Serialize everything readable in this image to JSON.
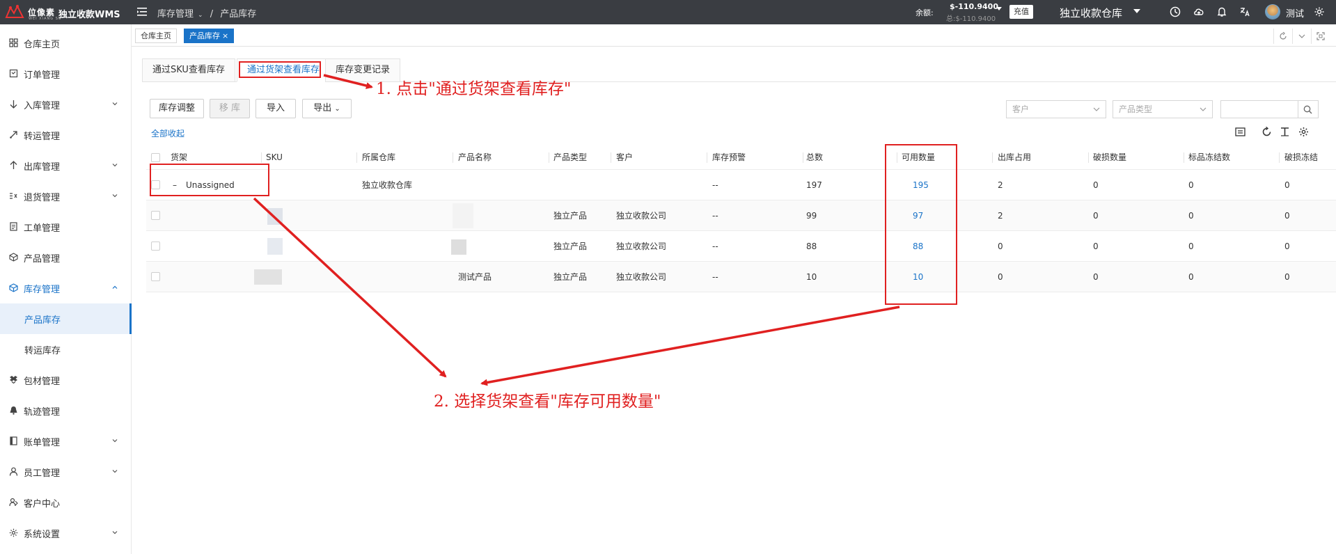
{
  "app": {
    "logo_text_cn": "位像素",
    "logo_text_en": "WEI XIANG SU",
    "name": "独立收款WMS"
  },
  "header": {
    "breadcrumb": [
      "库存管理",
      "/",
      "产品库存"
    ],
    "balance_label": "余额:",
    "balance_value": "$-110.9400",
    "balance_total": "总:$-110.9400",
    "recharge_label": "充值",
    "warehouse": "独立收款仓库",
    "user": "测试",
    "icons": [
      "clock-icon",
      "cloud-upload-icon",
      "bell-icon",
      "translate-icon"
    ]
  },
  "sidebar": {
    "items": [
      {
        "label": "仓库主页",
        "icon": "dashboard-icon",
        "expandable": false
      },
      {
        "label": "订单管理",
        "icon": "order-icon",
        "expandable": false
      },
      {
        "label": "入库管理",
        "icon": "inbound-icon",
        "expandable": true
      },
      {
        "label": "转运管理",
        "icon": "transfer-icon",
        "expandable": false
      },
      {
        "label": "出库管理",
        "icon": "outbound-icon",
        "expandable": true
      },
      {
        "label": "退货管理",
        "icon": "return-icon",
        "expandable": true
      },
      {
        "label": "工单管理",
        "icon": "workorder-icon",
        "expandable": false
      },
      {
        "label": "产品管理",
        "icon": "product-icon",
        "expandable": false
      },
      {
        "label": "库存管理",
        "icon": "inventory-icon",
        "expandable": true,
        "expanded": true
      },
      {
        "label": "产品库存",
        "sub": true,
        "active": true
      },
      {
        "label": "转运库存",
        "sub": true
      },
      {
        "label": "包材管理",
        "icon": "package-icon",
        "expandable": false
      },
      {
        "label": "轨迹管理",
        "icon": "track-icon",
        "expandable": false
      },
      {
        "label": "账单管理",
        "icon": "bill-icon",
        "expandable": true
      },
      {
        "label": "员工管理",
        "icon": "staff-icon",
        "expandable": true
      },
      {
        "label": "客户中心",
        "icon": "customer-icon",
        "expandable": false
      },
      {
        "label": "系统设置",
        "icon": "settings-icon",
        "expandable": true
      }
    ]
  },
  "page_tabs": [
    {
      "label": "仓库主页",
      "active": false
    },
    {
      "label": "产品库存",
      "active": true,
      "close": "×"
    }
  ],
  "sub_tabs": [
    {
      "label": "通过SKU查看库存",
      "active": false
    },
    {
      "label": "通过货架查看库存",
      "active": true
    },
    {
      "label": "库存变更记录",
      "active": false
    }
  ],
  "toolbar": {
    "adjust": "库存调整",
    "move": "移 库",
    "import": "导入",
    "export": "导出",
    "customer_placeholder": "客户",
    "product_type_placeholder": "产品类型",
    "collapse_all": "全部收起"
  },
  "table": {
    "columns": [
      "货架",
      "SKU",
      "所属仓库",
      "产品名称",
      "产品类型",
      "客户",
      "库存预警",
      "总数",
      "可用数量",
      "出库占用",
      "破损数量",
      "标品冻结数",
      "破损冻结"
    ],
    "rows": [
      {
        "shelf": "Unassigned",
        "sku": "",
        "warehouse": "独立收款仓库",
        "name": "",
        "type": "",
        "customer": "",
        "warn": "--",
        "total": "197",
        "available": "195",
        "occupied": "2",
        "damaged": "0",
        "frozen": "0",
        "damaged_frozen": "0"
      },
      {
        "shelf": "",
        "sku": "",
        "warehouse": "",
        "name": "",
        "type": "独立产品",
        "customer": "独立收款公司",
        "warn": "--",
        "total": "99",
        "available": "97",
        "occupied": "2",
        "damaged": "0",
        "frozen": "0",
        "damaged_frozen": "0"
      },
      {
        "shelf": "",
        "sku": "",
        "warehouse": "",
        "name": "",
        "type": "独立产品",
        "customer": "独立收款公司",
        "warn": "--",
        "total": "88",
        "available": "88",
        "occupied": "0",
        "damaged": "0",
        "frozen": "0",
        "damaged_frozen": "0"
      },
      {
        "shelf": "",
        "sku": "",
        "warehouse": "",
        "name": "测试产品",
        "type": "独立产品",
        "customer": "独立收款公司",
        "warn": "--",
        "total": "10",
        "available": "10",
        "occupied": "0",
        "damaged": "0",
        "frozen": "0",
        "damaged_frozen": "0"
      }
    ]
  },
  "annotations": {
    "step1": "1. 点击\"通过货架查看库存\"",
    "step2": "2. 选择货架查看\"库存可用数量\"",
    "color": "#e02020"
  },
  "colors": {
    "topbar": "#3a3d42",
    "accent": "#1a73c8"
  }
}
